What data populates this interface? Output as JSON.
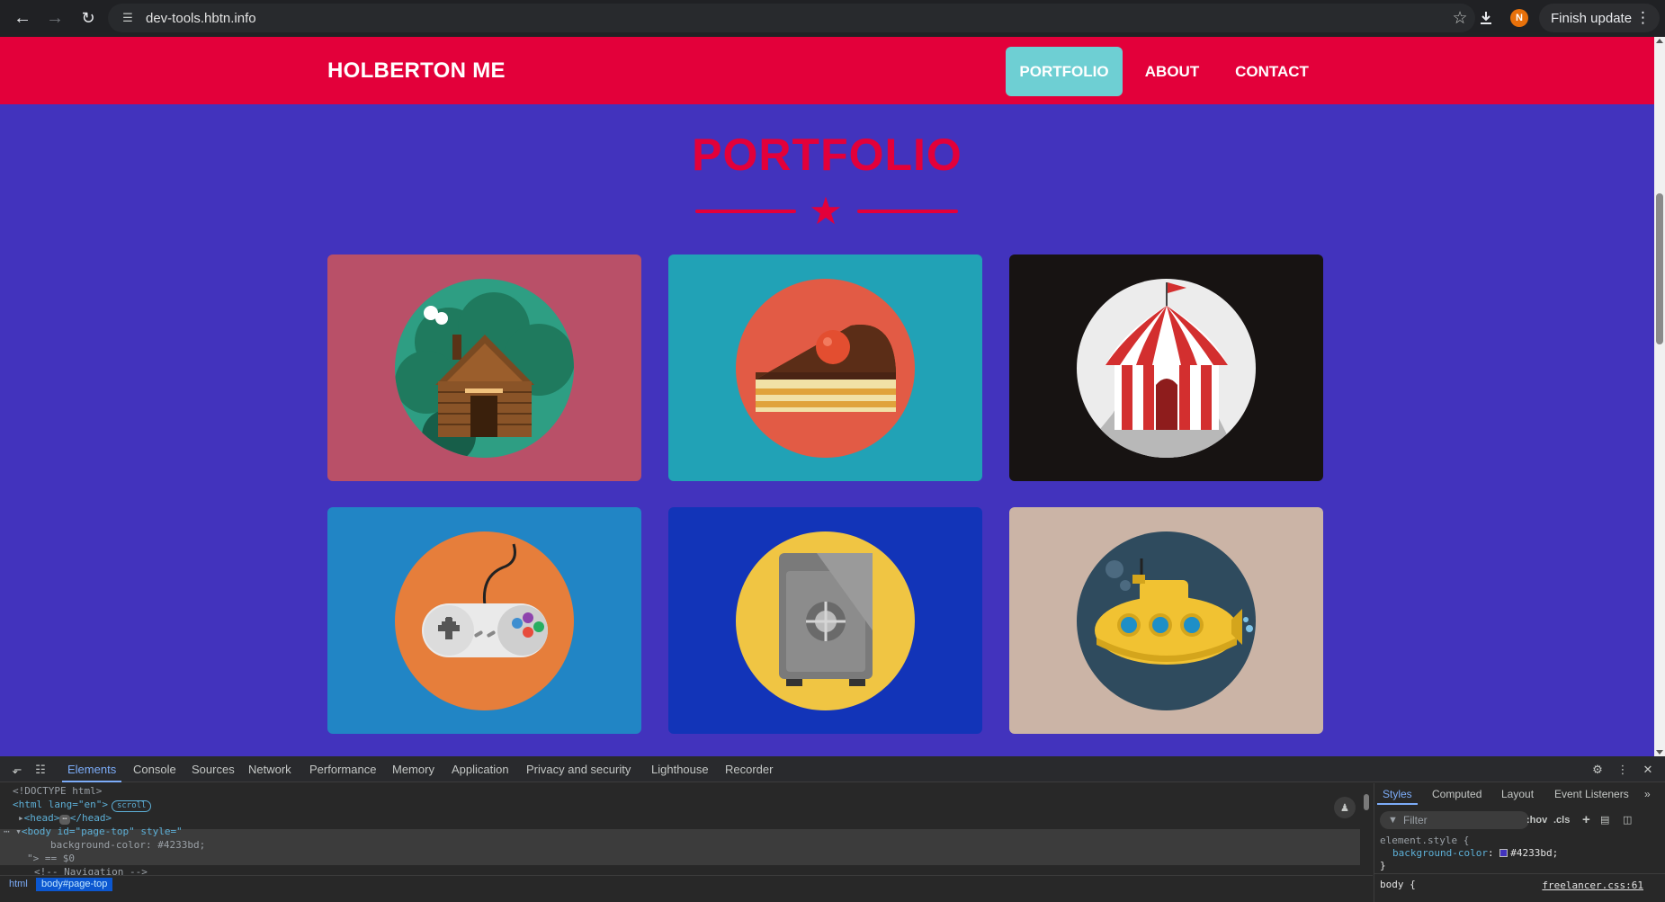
{
  "browser": {
    "url": "dev-tools.hbtn.info",
    "update_label": "Finish update",
    "avatar_letter": "N"
  },
  "site": {
    "brand": "HOLBERTON ME",
    "nav": [
      {
        "label": "PORTFOLIO",
        "active": true
      },
      {
        "label": "ABOUT",
        "active": false
      },
      {
        "label": "CONTACT",
        "active": false
      }
    ],
    "section_title": "PORTFOLIO",
    "colors": {
      "page_bg": "#4233bd",
      "nav_bg": "#e3003a",
      "active_nav": "#6ecfd3",
      "title": "#e3003a"
    },
    "portfolio": [
      {
        "name": "cabin",
        "bg": "#b95068",
        "circle": "#2e9e83"
      },
      {
        "name": "cake",
        "bg": "#21a2b6",
        "circle": "#e25b45"
      },
      {
        "name": "circus",
        "bg": "#171312",
        "circle": "#ececec"
      },
      {
        "name": "game",
        "bg": "#2185c5",
        "circle": "#e67e3b"
      },
      {
        "name": "safe",
        "bg": "#1234b8",
        "circle": "#f0c543"
      },
      {
        "name": "submarine",
        "bg": "#cbb4a6",
        "circle": "#2f4b5e"
      }
    ]
  },
  "devtools": {
    "tabs": [
      "Elements",
      "Console",
      "Sources",
      "Network",
      "Performance",
      "Memory",
      "Application",
      "Privacy and security",
      "Lighthouse",
      "Recorder"
    ],
    "dom": {
      "doctype": "<!DOCTYPE html>",
      "html_open": "<html lang=\"en\">",
      "scroll_badge": "scroll",
      "head": "<head>",
      "head_close": "</head>",
      "ellipsis": "⋯",
      "body_open": "<body id=\"page-top\" style=\"",
      "body_style": "background-color: #4233bd;",
      "body_close_quote": "\"> == $0",
      "comment": "<!-- Navigation -->"
    },
    "breadcrumbs": [
      "html",
      "body#page-top"
    ],
    "styles_tabs": [
      "Styles",
      "Computed",
      "Layout",
      "Event Listeners"
    ],
    "filter_placeholder": "Filter",
    "hov": ":hov",
    "cls": ".cls",
    "element_style_selector": "element.style {",
    "element_style_prop": "background-color",
    "element_style_value": "#4233bd;",
    "body_selector": "body {",
    "body_source": "freelancer.css:61"
  }
}
